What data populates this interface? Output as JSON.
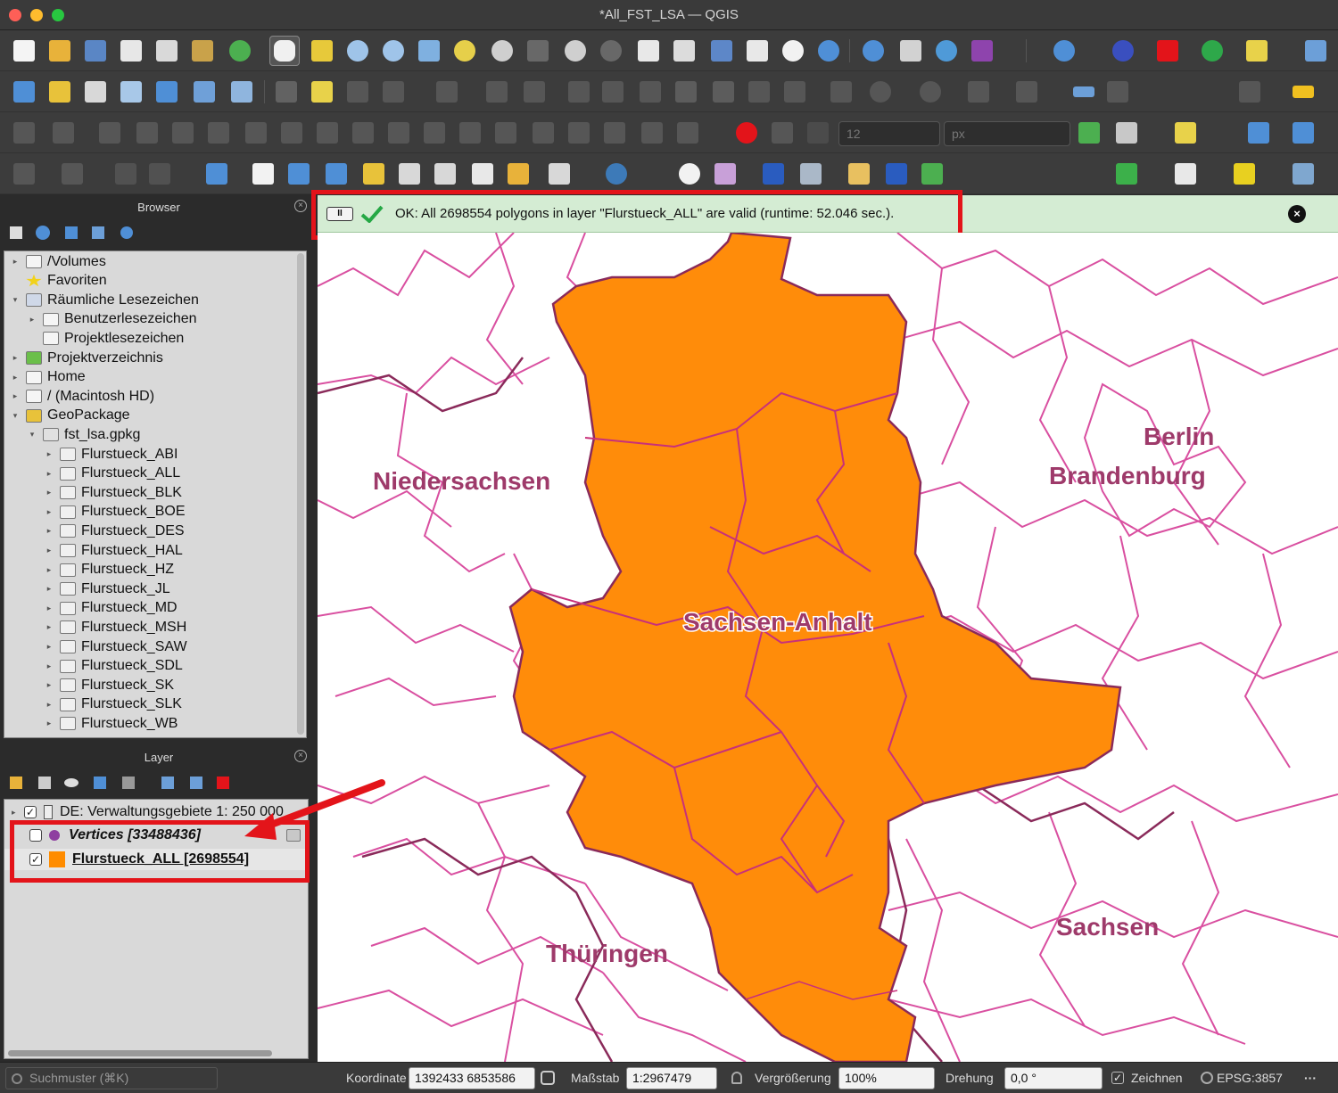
{
  "window": {
    "title": "*All_FST_LSA — QGIS"
  },
  "panels": {
    "browser": {
      "title": "Browser"
    },
    "layer": {
      "title": "Layer"
    }
  },
  "browser_tree": [
    {
      "label": "/Volumes",
      "indent": 0,
      "arrow": "▸",
      "icon": "folder-icon"
    },
    {
      "label": "Favoriten",
      "indent": 0,
      "arrow": "",
      "icon": "star-icon"
    },
    {
      "label": "Räumliche Lesezeichen",
      "indent": 0,
      "arrow": "▾",
      "icon": "bookmark-icon"
    },
    {
      "label": "Benutzerlesezeichen",
      "indent": 1,
      "arrow": "▸",
      "icon": "folder-icon"
    },
    {
      "label": "Projektlesezeichen",
      "indent": 1,
      "arrow": "",
      "icon": "folder-icon"
    },
    {
      "label": "Projektverzeichnis",
      "indent": 0,
      "arrow": "▸",
      "icon": "project-folder-icon"
    },
    {
      "label": "Home",
      "indent": 0,
      "arrow": "▸",
      "icon": "home-icon"
    },
    {
      "label": "/ (Macintosh HD)",
      "indent": 0,
      "arrow": "▸",
      "icon": "folder-icon"
    },
    {
      "label": "GeoPackage",
      "indent": 0,
      "arrow": "▾",
      "icon": "geopackage-icon"
    },
    {
      "label": "fst_lsa.gpkg",
      "indent": 1,
      "arrow": "▾",
      "icon": "database-icon"
    },
    {
      "label": "Flurstueck_ABI",
      "indent": 2,
      "arrow": "▸",
      "icon": "polygon-layer-icon"
    },
    {
      "label": "Flurstueck_ALL",
      "indent": 2,
      "arrow": "▸",
      "icon": "polygon-layer-icon"
    },
    {
      "label": "Flurstueck_BLK",
      "indent": 2,
      "arrow": "▸",
      "icon": "polygon-layer-icon"
    },
    {
      "label": "Flurstueck_BOE",
      "indent": 2,
      "arrow": "▸",
      "icon": "polygon-layer-icon"
    },
    {
      "label": "Flurstueck_DES",
      "indent": 2,
      "arrow": "▸",
      "icon": "polygon-layer-icon"
    },
    {
      "label": "Flurstueck_HAL",
      "indent": 2,
      "arrow": "▸",
      "icon": "polygon-layer-icon"
    },
    {
      "label": "Flurstueck_HZ",
      "indent": 2,
      "arrow": "▸",
      "icon": "polygon-layer-icon"
    },
    {
      "label": "Flurstueck_JL",
      "indent": 2,
      "arrow": "▸",
      "icon": "polygon-layer-icon"
    },
    {
      "label": "Flurstueck_MD",
      "indent": 2,
      "arrow": "▸",
      "icon": "polygon-layer-icon"
    },
    {
      "label": "Flurstueck_MSH",
      "indent": 2,
      "arrow": "▸",
      "icon": "polygon-layer-icon"
    },
    {
      "label": "Flurstueck_SAW",
      "indent": 2,
      "arrow": "▸",
      "icon": "polygon-layer-icon"
    },
    {
      "label": "Flurstueck_SDL",
      "indent": 2,
      "arrow": "▸",
      "icon": "polygon-layer-icon"
    },
    {
      "label": "Flurstueck_SK",
      "indent": 2,
      "arrow": "▸",
      "icon": "polygon-layer-icon"
    },
    {
      "label": "Flurstueck_SLK",
      "indent": 2,
      "arrow": "▸",
      "icon": "polygon-layer-icon"
    },
    {
      "label": "Flurstueck_WB",
      "indent": 2,
      "arrow": "▸",
      "icon": "polygon-layer-icon"
    }
  ],
  "layers": [
    {
      "label": "DE: Verwaltungsgebiete 1: 250 000",
      "checked": true,
      "style": "normal",
      "icon": "group-icon",
      "swatch": ""
    },
    {
      "label": "Vertices [33488436]",
      "checked": false,
      "style": "italic-bold",
      "icon": "point-symbol-icon",
      "swatch": "#8e3fa0"
    },
    {
      "label": "Flurstueck_ALL [2698554]",
      "checked": true,
      "style": "underline-bold",
      "icon": "polygon-symbol-icon",
      "swatch": "#ff8c00"
    }
  ],
  "message_bar": {
    "text": "OK: All 2698554 polygons in layer \"Flurstueck_ALL\" are valid (runtime: 52.046 sec.).",
    "status_icon": "checkmark-icon",
    "level": "success"
  },
  "map": {
    "labels": [
      {
        "text": "Niedersachsen",
        "role": "state-label"
      },
      {
        "text": "Berlin",
        "role": "state-label"
      },
      {
        "text": "Brandenburg",
        "role": "state-label"
      },
      {
        "text": "Sachsen-Anhalt",
        "role": "highlight-label"
      },
      {
        "text": "Thüringen",
        "role": "state-label"
      },
      {
        "text": "Sachsen",
        "role": "state-label"
      }
    ],
    "fill_color": "#ff8c0a",
    "boundary_color": "#d94fa0",
    "label_color": "#9e3a6a"
  },
  "toolbar": {
    "font_size_value": "12",
    "font_unit_value": "px"
  },
  "status_bar": {
    "search_placeholder": "Suchmuster (⌘K)",
    "coordinate_label": "Koordinate",
    "coordinate_value": "1392433  6853586",
    "scale_label": "Maßstab",
    "scale_value": "1:2967479",
    "magnifier_label": "Vergrößerung",
    "magnifier_value": "100%",
    "rotation_label": "Drehung",
    "rotation_value": "0,0 °",
    "render_label": "Zeichnen",
    "crs_label": "EPSG:3857"
  }
}
